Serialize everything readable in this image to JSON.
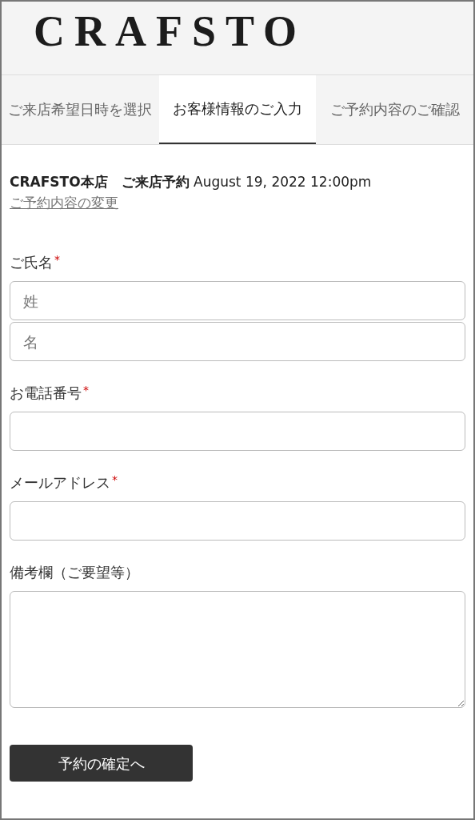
{
  "header": {
    "logo": "CRAFSTO"
  },
  "tabs": [
    {
      "label": "ご来店希望日時を選択",
      "selected": false
    },
    {
      "label": "お客様情報のご入力",
      "selected": true
    },
    {
      "label": "ご予約内容のご確認",
      "selected": false
    }
  ],
  "booking": {
    "summary": "**CRAFSTO本店　ご来店予約** August 19, 2022 12:00pm",
    "change_link": "ご予約内容の変更"
  },
  "fields": [
    {
      "kind": "text",
      "label": "ご氏名",
      "required_mark": "*",
      "placeholders": [
        "姓",
        "名"
      ]
    },
    {
      "kind": "text",
      "label": "お電話番号",
      "required_mark": "*"
    },
    {
      "kind": "text",
      "label": "メールアドレス",
      "required_mark": "*"
    },
    {
      "kind": "textarea",
      "label": "備考欄（ご要望等）"
    }
  ],
  "submit": {
    "label": "予約の確定へ"
  }
}
